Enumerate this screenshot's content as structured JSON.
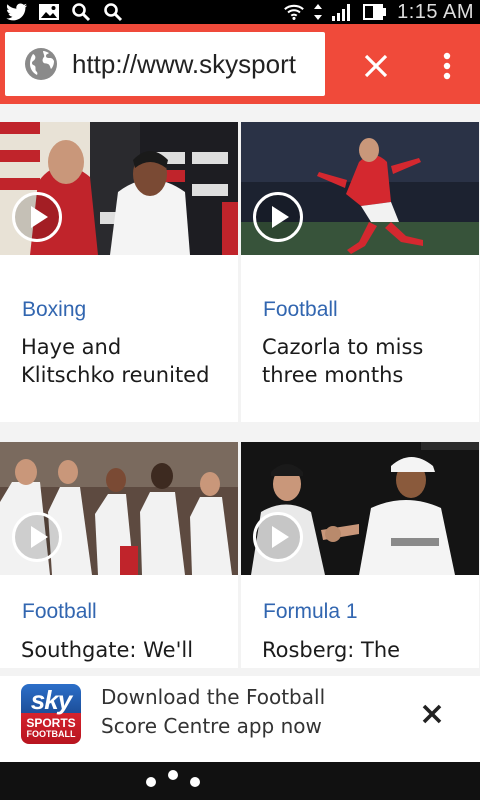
{
  "status_bar": {
    "time": "1:15 AM",
    "icons": [
      "twitter-icon",
      "gallery-icon",
      "search-icon",
      "search-icon",
      "wifi-icon",
      "data-arrows-icon",
      "signal-icon",
      "battery-icon"
    ]
  },
  "browser": {
    "url": "http://www.skysport",
    "toolbar_color": "#f04a3a",
    "icons": [
      "globe-icon",
      "close-icon",
      "more-vert-icon"
    ]
  },
  "articles": [
    {
      "category": "Boxing",
      "headline": "Haye and Klitschko reunited",
      "thumbnail": "boxing-photo"
    },
    {
      "category": "Football",
      "headline": "Cazorla to miss three months",
      "thumbnail": "football-player-photo"
    },
    {
      "category": "Football",
      "headline": "Southgate: We'll",
      "thumbnail": "england-team-photo"
    },
    {
      "category": "Formula 1",
      "headline": "Rosberg: The",
      "thumbnail": "f1-drivers-photo"
    }
  ],
  "banner": {
    "app_icon_brand": "sky",
    "app_icon_line1": "SPORTS",
    "app_icon_line2": "FOOTBALL",
    "text": "Download the Football Score Centre app now"
  },
  "colors": {
    "category": "#3266b0",
    "headline": "#1b1b1b",
    "accent": "#f04a3a"
  }
}
